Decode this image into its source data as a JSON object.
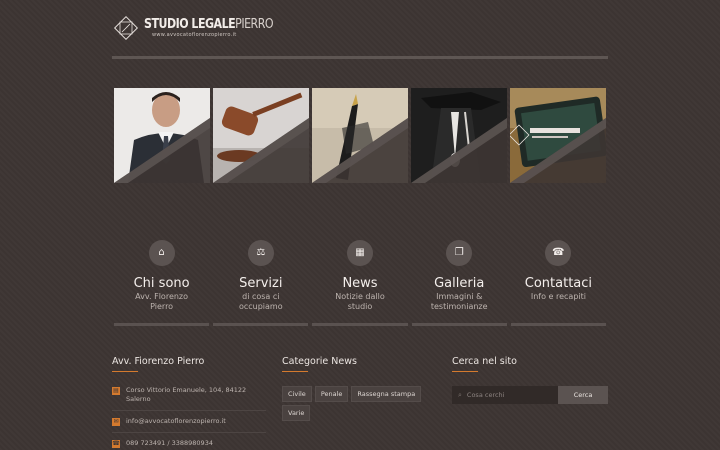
{
  "header": {
    "logo_name_bold": "STUDIO LEGALE",
    "logo_name_light": "PIERRO",
    "logo_url": "www.avvocatoflorenzopierro.it"
  },
  "nav": [
    {
      "title": "Chi sono",
      "subtitle": "Avv. Florenzo Pierro",
      "icon": "home-icon"
    },
    {
      "title": "Servizi",
      "subtitle": "di cosa ci occupiamo",
      "icon": "gavel-icon"
    },
    {
      "title": "News",
      "subtitle": "Notizie dallo studio",
      "icon": "film-icon"
    },
    {
      "title": "Galleria",
      "subtitle": "Immagini & testimonianze",
      "icon": "gallery-icon"
    },
    {
      "title": "Contattaci",
      "subtitle": "Info e recapiti",
      "icon": "phone-icon"
    }
  ],
  "footer": {
    "contact": {
      "title": "Avv. Fiorenzo Pierro",
      "address": "Corso Vittorio Emanuele, 104, 84122 Salerno",
      "email": "info@avvocatoflorenzopierro.it",
      "phone": "089 723491 / 3388980934"
    },
    "categories": {
      "title": "Categorie News",
      "tags": [
        "Civile",
        "Penale",
        "Rassegna stampa",
        "Varie"
      ]
    },
    "search": {
      "title": "Cerca nel sito",
      "placeholder": "Cosa cerchi",
      "button": "Cerca"
    }
  },
  "colors": {
    "accent": "#d47a2e",
    "background": "#3d3533"
  }
}
